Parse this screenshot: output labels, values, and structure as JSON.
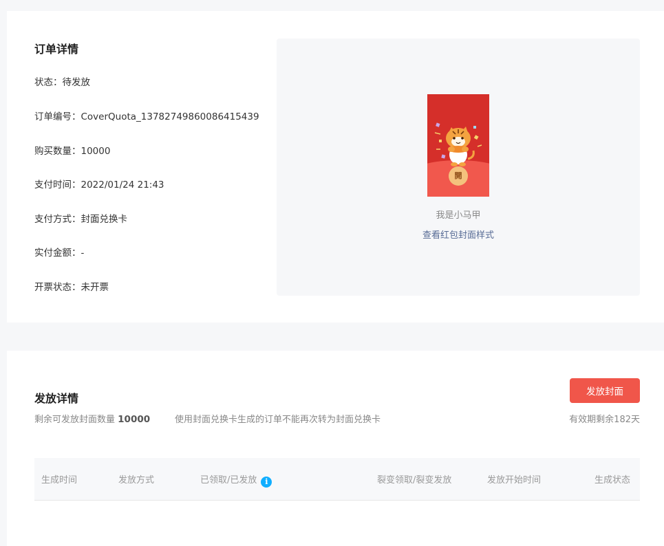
{
  "order": {
    "title": "订单详情",
    "rows": [
      {
        "label": "状态：",
        "value": "待发放"
      },
      {
        "label": "订单编号：",
        "value": "CoverQuota_13782749860086415439"
      },
      {
        "label": "购买数量：",
        "value": "10000"
      },
      {
        "label": "支付时间：",
        "value": "2022/01/24 21:43"
      },
      {
        "label": "支付方式：",
        "value": "封面兑换卡"
      },
      {
        "label": "实付金额：",
        "value": "-"
      },
      {
        "label": "开票状态：",
        "value": "未开票"
      }
    ]
  },
  "preview": {
    "open_char": "開",
    "name": "我是小马甲",
    "link": "查看红包封面样式",
    "colors": {
      "envelope_top": "#d52f2a",
      "envelope_bottom": "#f1584d",
      "open_button": "#f4c27d"
    }
  },
  "issue": {
    "title": "发放详情",
    "remain_label": "剩余可发放封面数量",
    "remain_count": "10000",
    "note": "使用封面兑换卡生成的订单不能再次转为封面兑换卡",
    "button": "发放封面",
    "validity": "有效期剩余182天",
    "table_headers": [
      "生成时间",
      "发放方式",
      "已领取/已发放",
      "裂变领取/裂变发放",
      "发放开始时间",
      "生成状态"
    ],
    "info_icon_char": "i",
    "colors": {
      "primary_button": "#f0564a",
      "link": "#576b95",
      "info": "#10aeff"
    }
  }
}
